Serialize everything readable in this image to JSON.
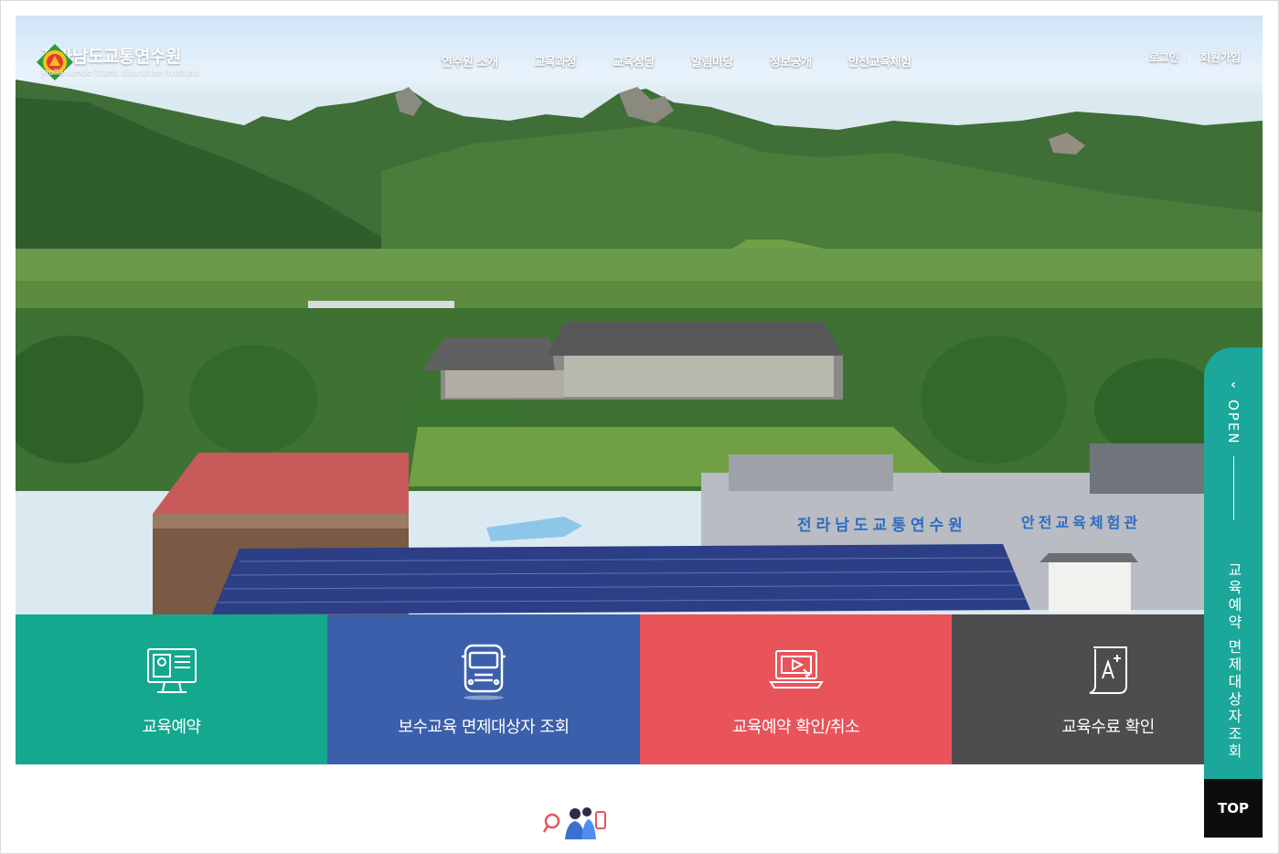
{
  "header": {
    "logo_title": "전라남도교통연수원",
    "logo_subtitle": "Jeollanamdo Traffic Education Institute",
    "nav": [
      "연수원 소개",
      "교육과정",
      "교육상담",
      "알림마당",
      "정보공개",
      "안전교육체험"
    ],
    "util": {
      "login": "로그인",
      "join": "회원가입"
    }
  },
  "hero": {
    "building_sign_1": "전라남도교통연수원",
    "building_sign_2": "안전교육체험관"
  },
  "quick_menu": [
    {
      "label": "교육예약",
      "icon": "monitor-profile-icon",
      "color": "#14a88f"
    },
    {
      "label": "보수교육 면제대상자 조회",
      "icon": "bus-icon",
      "color": "#3b5fab"
    },
    {
      "label": "교육예약 확인/취소",
      "icon": "laptop-play-icon",
      "color": "#e8545a"
    },
    {
      "label": "교육수료 확인",
      "icon": "certificate-icon",
      "color": "#4d4c4f"
    }
  ],
  "side_panel": {
    "toggle": "OPEN",
    "text": "교육예약 면제대상자조회",
    "chevron": "‹"
  },
  "top_button": "TOP"
}
